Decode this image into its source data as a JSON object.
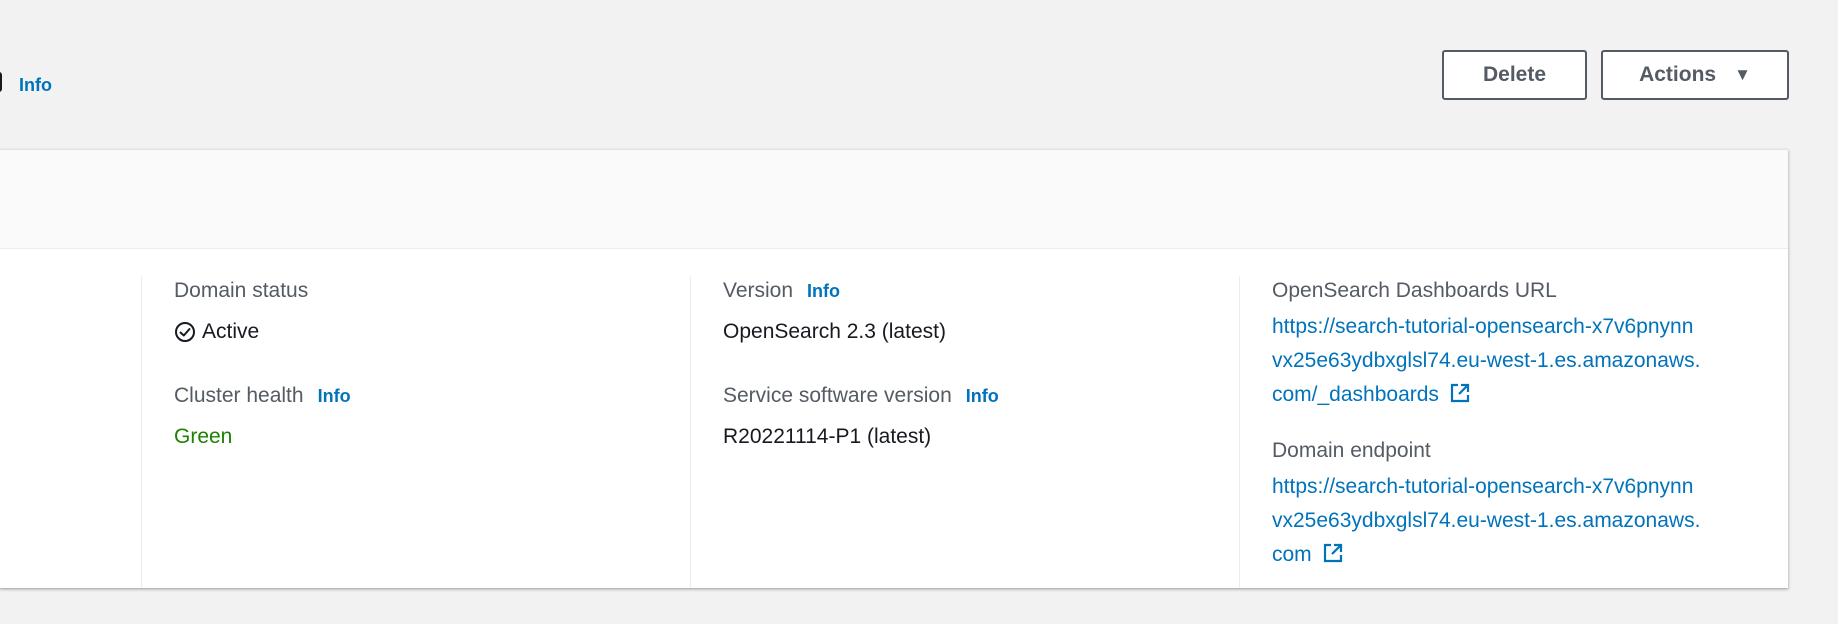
{
  "header": {
    "info_label": "Info",
    "delete_label": "Delete",
    "actions_label": "Actions",
    "actions_caret": "▼"
  },
  "general": {
    "domain_status": {
      "label": "Domain status",
      "value": "Active"
    },
    "cluster_health": {
      "label": "Cluster health",
      "info": "Info",
      "value": "Green"
    },
    "version": {
      "label": "Version",
      "info": "Info",
      "value": "OpenSearch 2.3 (latest)"
    },
    "service_software_version": {
      "label": "Service software version",
      "info": "Info",
      "value": "R20221114-P1 (latest)"
    },
    "dashboards_url": {
      "label": "OpenSearch Dashboards URL",
      "value": "https://search-tutorial-opensearch-x7v6pnynnvx25e63ydbxglsl74.eu-west-1.es.amazonaws.com/_dashboards"
    },
    "domain_endpoint": {
      "label": "Domain endpoint",
      "value": "https://search-tutorial-opensearch-x7v6pnynnvx25e63ydbxglsl74.eu-west-1.es.amazonaws.com"
    }
  },
  "colors": {
    "link": "#0073bb",
    "status_green": "#1d8102",
    "text": "#16191f",
    "label": "#545b64"
  },
  "icons": {
    "status": "check-circle-icon",
    "external": "external-link-icon",
    "dropdown": "caret-down-icon"
  }
}
